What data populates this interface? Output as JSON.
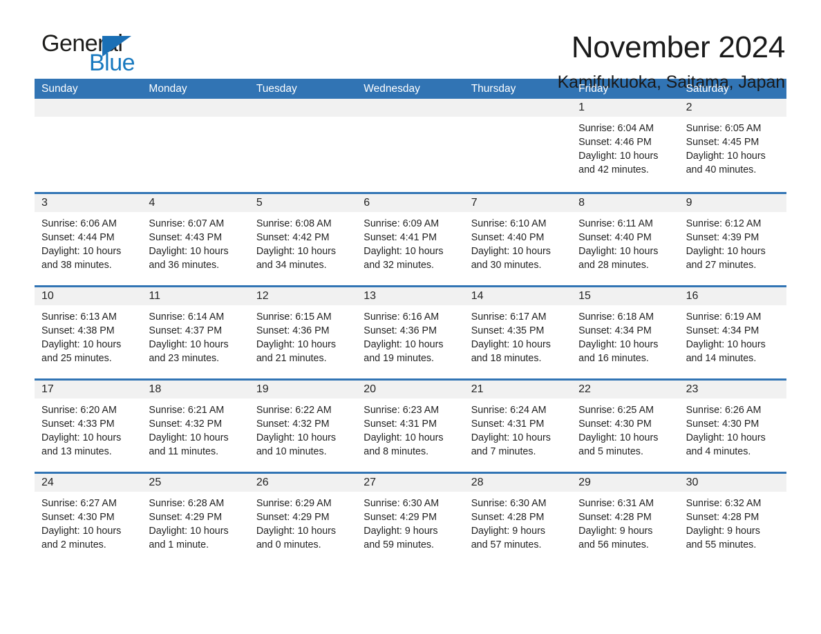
{
  "logo": {
    "word_one": "General",
    "word_two": "Blue",
    "icon": "triangle-mark"
  },
  "header": {
    "month_title": "November 2024",
    "location": "Kamifukuoka, Saitama, Japan"
  },
  "colors": {
    "header_blue": "#3174b4",
    "logo_blue": "#1879bf",
    "day_number_bg": "#f1f1f1",
    "text": "#222222"
  },
  "weekdays": [
    "Sunday",
    "Monday",
    "Tuesday",
    "Wednesday",
    "Thursday",
    "Friday",
    "Saturday"
  ],
  "weeks": [
    [
      {
        "day": "",
        "sunrise": "",
        "sunset": "",
        "daylight_1": "",
        "daylight_2": ""
      },
      {
        "day": "",
        "sunrise": "",
        "sunset": "",
        "daylight_1": "",
        "daylight_2": ""
      },
      {
        "day": "",
        "sunrise": "",
        "sunset": "",
        "daylight_1": "",
        "daylight_2": ""
      },
      {
        "day": "",
        "sunrise": "",
        "sunset": "",
        "daylight_1": "",
        "daylight_2": ""
      },
      {
        "day": "",
        "sunrise": "",
        "sunset": "",
        "daylight_1": "",
        "daylight_2": ""
      },
      {
        "day": "1",
        "sunrise": "Sunrise: 6:04 AM",
        "sunset": "Sunset: 4:46 PM",
        "daylight_1": "Daylight: 10 hours",
        "daylight_2": "and 42 minutes."
      },
      {
        "day": "2",
        "sunrise": "Sunrise: 6:05 AM",
        "sunset": "Sunset: 4:45 PM",
        "daylight_1": "Daylight: 10 hours",
        "daylight_2": "and 40 minutes."
      }
    ],
    [
      {
        "day": "3",
        "sunrise": "Sunrise: 6:06 AM",
        "sunset": "Sunset: 4:44 PM",
        "daylight_1": "Daylight: 10 hours",
        "daylight_2": "and 38 minutes."
      },
      {
        "day": "4",
        "sunrise": "Sunrise: 6:07 AM",
        "sunset": "Sunset: 4:43 PM",
        "daylight_1": "Daylight: 10 hours",
        "daylight_2": "and 36 minutes."
      },
      {
        "day": "5",
        "sunrise": "Sunrise: 6:08 AM",
        "sunset": "Sunset: 4:42 PM",
        "daylight_1": "Daylight: 10 hours",
        "daylight_2": "and 34 minutes."
      },
      {
        "day": "6",
        "sunrise": "Sunrise: 6:09 AM",
        "sunset": "Sunset: 4:41 PM",
        "daylight_1": "Daylight: 10 hours",
        "daylight_2": "and 32 minutes."
      },
      {
        "day": "7",
        "sunrise": "Sunrise: 6:10 AM",
        "sunset": "Sunset: 4:40 PM",
        "daylight_1": "Daylight: 10 hours",
        "daylight_2": "and 30 minutes."
      },
      {
        "day": "8",
        "sunrise": "Sunrise: 6:11 AM",
        "sunset": "Sunset: 4:40 PM",
        "daylight_1": "Daylight: 10 hours",
        "daylight_2": "and 28 minutes."
      },
      {
        "day": "9",
        "sunrise": "Sunrise: 6:12 AM",
        "sunset": "Sunset: 4:39 PM",
        "daylight_1": "Daylight: 10 hours",
        "daylight_2": "and 27 minutes."
      }
    ],
    [
      {
        "day": "10",
        "sunrise": "Sunrise: 6:13 AM",
        "sunset": "Sunset: 4:38 PM",
        "daylight_1": "Daylight: 10 hours",
        "daylight_2": "and 25 minutes."
      },
      {
        "day": "11",
        "sunrise": "Sunrise: 6:14 AM",
        "sunset": "Sunset: 4:37 PM",
        "daylight_1": "Daylight: 10 hours",
        "daylight_2": "and 23 minutes."
      },
      {
        "day": "12",
        "sunrise": "Sunrise: 6:15 AM",
        "sunset": "Sunset: 4:36 PM",
        "daylight_1": "Daylight: 10 hours",
        "daylight_2": "and 21 minutes."
      },
      {
        "day": "13",
        "sunrise": "Sunrise: 6:16 AM",
        "sunset": "Sunset: 4:36 PM",
        "daylight_1": "Daylight: 10 hours",
        "daylight_2": "and 19 minutes."
      },
      {
        "day": "14",
        "sunrise": "Sunrise: 6:17 AM",
        "sunset": "Sunset: 4:35 PM",
        "daylight_1": "Daylight: 10 hours",
        "daylight_2": "and 18 minutes."
      },
      {
        "day": "15",
        "sunrise": "Sunrise: 6:18 AM",
        "sunset": "Sunset: 4:34 PM",
        "daylight_1": "Daylight: 10 hours",
        "daylight_2": "and 16 minutes."
      },
      {
        "day": "16",
        "sunrise": "Sunrise: 6:19 AM",
        "sunset": "Sunset: 4:34 PM",
        "daylight_1": "Daylight: 10 hours",
        "daylight_2": "and 14 minutes."
      }
    ],
    [
      {
        "day": "17",
        "sunrise": "Sunrise: 6:20 AM",
        "sunset": "Sunset: 4:33 PM",
        "daylight_1": "Daylight: 10 hours",
        "daylight_2": "and 13 minutes."
      },
      {
        "day": "18",
        "sunrise": "Sunrise: 6:21 AM",
        "sunset": "Sunset: 4:32 PM",
        "daylight_1": "Daylight: 10 hours",
        "daylight_2": "and 11 minutes."
      },
      {
        "day": "19",
        "sunrise": "Sunrise: 6:22 AM",
        "sunset": "Sunset: 4:32 PM",
        "daylight_1": "Daylight: 10 hours",
        "daylight_2": "and 10 minutes."
      },
      {
        "day": "20",
        "sunrise": "Sunrise: 6:23 AM",
        "sunset": "Sunset: 4:31 PM",
        "daylight_1": "Daylight: 10 hours",
        "daylight_2": "and 8 minutes."
      },
      {
        "day": "21",
        "sunrise": "Sunrise: 6:24 AM",
        "sunset": "Sunset: 4:31 PM",
        "daylight_1": "Daylight: 10 hours",
        "daylight_2": "and 7 minutes."
      },
      {
        "day": "22",
        "sunrise": "Sunrise: 6:25 AM",
        "sunset": "Sunset: 4:30 PM",
        "daylight_1": "Daylight: 10 hours",
        "daylight_2": "and 5 minutes."
      },
      {
        "day": "23",
        "sunrise": "Sunrise: 6:26 AM",
        "sunset": "Sunset: 4:30 PM",
        "daylight_1": "Daylight: 10 hours",
        "daylight_2": "and 4 minutes."
      }
    ],
    [
      {
        "day": "24",
        "sunrise": "Sunrise: 6:27 AM",
        "sunset": "Sunset: 4:30 PM",
        "daylight_1": "Daylight: 10 hours",
        "daylight_2": "and 2 minutes."
      },
      {
        "day": "25",
        "sunrise": "Sunrise: 6:28 AM",
        "sunset": "Sunset: 4:29 PM",
        "daylight_1": "Daylight: 10 hours",
        "daylight_2": "and 1 minute."
      },
      {
        "day": "26",
        "sunrise": "Sunrise: 6:29 AM",
        "sunset": "Sunset: 4:29 PM",
        "daylight_1": "Daylight: 10 hours",
        "daylight_2": "and 0 minutes."
      },
      {
        "day": "27",
        "sunrise": "Sunrise: 6:30 AM",
        "sunset": "Sunset: 4:29 PM",
        "daylight_1": "Daylight: 9 hours",
        "daylight_2": "and 59 minutes."
      },
      {
        "day": "28",
        "sunrise": "Sunrise: 6:30 AM",
        "sunset": "Sunset: 4:28 PM",
        "daylight_1": "Daylight: 9 hours",
        "daylight_2": "and 57 minutes."
      },
      {
        "day": "29",
        "sunrise": "Sunrise: 6:31 AM",
        "sunset": "Sunset: 4:28 PM",
        "daylight_1": "Daylight: 9 hours",
        "daylight_2": "and 56 minutes."
      },
      {
        "day": "30",
        "sunrise": "Sunrise: 6:32 AM",
        "sunset": "Sunset: 4:28 PM",
        "daylight_1": "Daylight: 9 hours",
        "daylight_2": "and 55 minutes."
      }
    ]
  ]
}
